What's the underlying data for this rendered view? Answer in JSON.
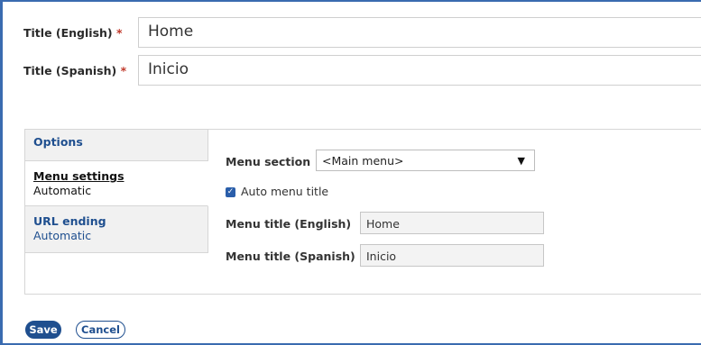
{
  "title_english": {
    "label": "Title (English)",
    "required_mark": "*",
    "value": "Home"
  },
  "title_spanish": {
    "label": "Title (Spanish)",
    "required_mark": "*",
    "value": "Inicio"
  },
  "tabs": [
    {
      "title": "Options",
      "subtitle": ""
    },
    {
      "title": "Menu settings",
      "subtitle": "Automatic"
    },
    {
      "title": "URL ending",
      "subtitle": "Automatic"
    }
  ],
  "menu": {
    "section_label": "Menu section",
    "section_value": "<Main menu>",
    "auto_title_label": "Auto menu title",
    "auto_title_checked": true,
    "title_english_label": "Menu title (English)",
    "title_english_value": "Home",
    "title_spanish_label": "Menu title (Spanish)",
    "title_spanish_value": "Inicio"
  },
  "buttons": {
    "save": "Save",
    "cancel": "Cancel"
  },
  "colors": {
    "accent": "#1f4f8f",
    "required": "#c0392b",
    "frame": "#3a6bb0"
  }
}
